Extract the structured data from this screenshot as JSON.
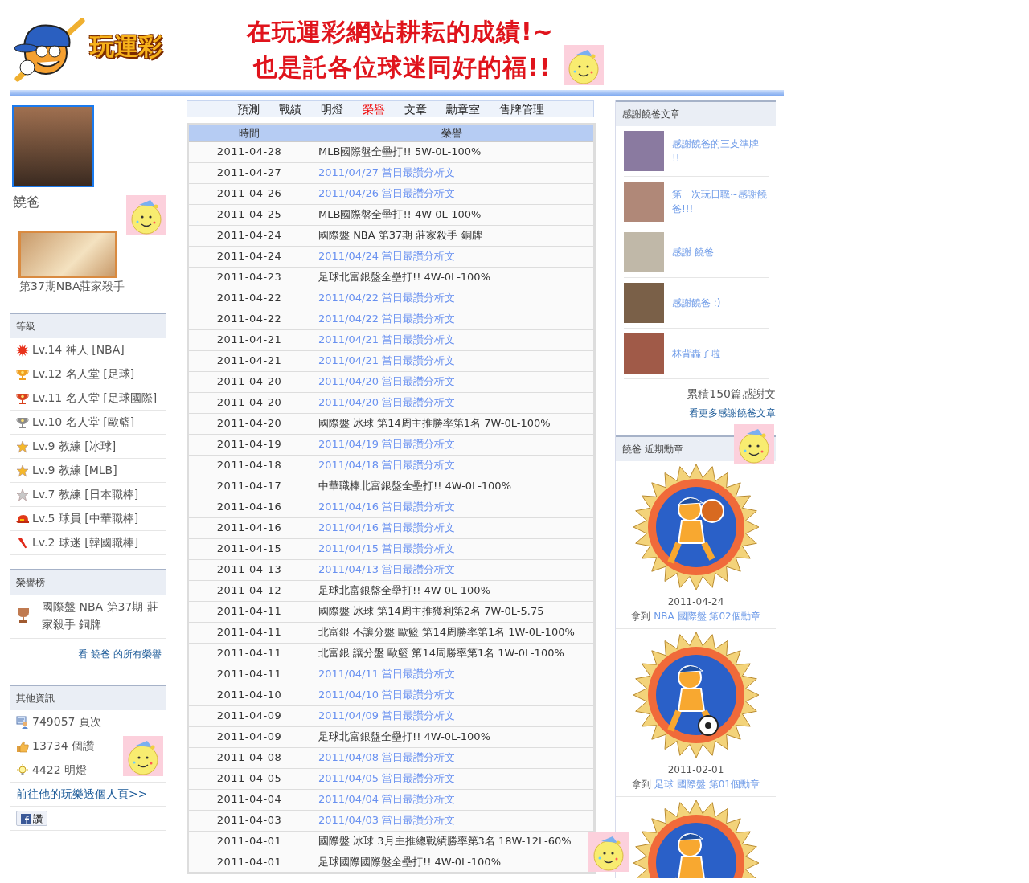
{
  "header": {
    "logo_text": "玩運彩",
    "slogan_lines": [
      "在玩運彩網站耕耘的成績!~",
      "也是託各位球迷同好的福!!"
    ]
  },
  "profile": {
    "name": "饒爸",
    "award_caption": "第37期NBA莊家殺手"
  },
  "levels": {
    "title": "等級",
    "items": [
      {
        "text": "Lv.14 神人 [NBA]",
        "kind": "burst",
        "color": "#e8321c"
      },
      {
        "text": "Lv.12 名人堂 [足球]",
        "kind": "trophy",
        "color": "#f0a020"
      },
      {
        "text": "Lv.11 名人堂 [足球國際]",
        "kind": "trophy",
        "color": "#d8401c"
      },
      {
        "text": "Lv.10 名人堂 [歐籃]",
        "kind": "trophy",
        "color": "#8a8a8a"
      },
      {
        "text": "Lv.9 教練 [冰球]",
        "kind": "star",
        "color": "#f5b82a"
      },
      {
        "text": "Lv.9 教練 [MLB]",
        "kind": "star",
        "color": "#f5b82a"
      },
      {
        "text": "Lv.7 教練 [日本職棒]",
        "kind": "star",
        "color": "#c8c8c8"
      },
      {
        "text": "Lv.5 球員 [中華職棒]",
        "kind": "cap",
        "color": "#e03a1a"
      },
      {
        "text": "Lv.2 球迷 [韓國職棒]",
        "kind": "horn",
        "color": "#e02a1a"
      }
    ]
  },
  "honors": {
    "title": "榮譽榜",
    "items": [
      {
        "text": "國際盤 NBA 第37期 莊家殺手 銅牌"
      }
    ],
    "more_link": "看 饒爸 的所有榮譽"
  },
  "other_info": {
    "title": "其他資訊",
    "items": [
      {
        "text": "749057 頁次",
        "kind": "views"
      },
      {
        "text": "13734 個讚",
        "kind": "like"
      },
      {
        "text": "4422 明燈",
        "kind": "bulb"
      }
    ],
    "page_link": "前往他的玩樂透個人頁>>",
    "like_button": "讚"
  },
  "tabs": [
    {
      "label": "預測",
      "selected": false
    },
    {
      "label": "戰績",
      "selected": false
    },
    {
      "label": "明燈",
      "selected": false
    },
    {
      "label": "榮譽",
      "selected": true
    },
    {
      "label": "文章",
      "selected": false
    },
    {
      "label": "勳章室",
      "selected": false
    },
    {
      "label": "售牌管理",
      "selected": false
    }
  ],
  "table": {
    "columns": [
      "時間",
      "榮譽"
    ],
    "rows": [
      {
        "date": "2011-04-28",
        "honor": "MLB國際盤全壘打!! 5W-0L-100%",
        "kind": "text"
      },
      {
        "date": "2011-04-27",
        "honor": "2011/04/27 當日最讚分析文",
        "kind": "link"
      },
      {
        "date": "2011-04-26",
        "honor": "2011/04/26 當日最讚分析文",
        "kind": "link"
      },
      {
        "date": "2011-04-25",
        "honor": "MLB國際盤全壘打!! 4W-0L-100%",
        "kind": "text"
      },
      {
        "date": "2011-04-24",
        "honor": "國際盤 NBA 第37期 莊家殺手 銅牌",
        "kind": "text"
      },
      {
        "date": "2011-04-24",
        "honor": "2011/04/24 當日最讚分析文",
        "kind": "link"
      },
      {
        "date": "2011-04-23",
        "honor": "足球北富銀盤全壘打!! 4W-0L-100%",
        "kind": "text"
      },
      {
        "date": "2011-04-22",
        "honor": "2011/04/22 當日最讚分析文",
        "kind": "link"
      },
      {
        "date": "2011-04-22",
        "honor": "2011/04/22 當日最讚分析文",
        "kind": "link"
      },
      {
        "date": "2011-04-21",
        "honor": "2011/04/21 當日最讚分析文",
        "kind": "link"
      },
      {
        "date": "2011-04-21",
        "honor": "2011/04/21 當日最讚分析文",
        "kind": "link"
      },
      {
        "date": "2011-04-20",
        "honor": "2011/04/20 當日最讚分析文",
        "kind": "link"
      },
      {
        "date": "2011-04-20",
        "honor": "2011/04/20 當日最讚分析文",
        "kind": "link"
      },
      {
        "date": "2011-04-20",
        "honor": "國際盤 冰球 第14周主推勝率第1名 7W-0L-100%",
        "kind": "text"
      },
      {
        "date": "2011-04-19",
        "honor": "2011/04/19 當日最讚分析文",
        "kind": "link"
      },
      {
        "date": "2011-04-18",
        "honor": "2011/04/18 當日最讚分析文",
        "kind": "link"
      },
      {
        "date": "2011-04-17",
        "honor": "中華職棒北富銀盤全壘打!! 4W-0L-100%",
        "kind": "text"
      },
      {
        "date": "2011-04-16",
        "honor": "2011/04/16 當日最讚分析文",
        "kind": "link"
      },
      {
        "date": "2011-04-16",
        "honor": "2011/04/16 當日最讚分析文",
        "kind": "link"
      },
      {
        "date": "2011-04-15",
        "honor": "2011/04/15 當日最讚分析文",
        "kind": "link"
      },
      {
        "date": "2011-04-13",
        "honor": "2011/04/13 當日最讚分析文",
        "kind": "link"
      },
      {
        "date": "2011-04-12",
        "honor": "足球北富銀盤全壘打!! 4W-0L-100%",
        "kind": "text"
      },
      {
        "date": "2011-04-11",
        "honor": "國際盤 冰球 第14周主推獲利第2名 7W-0L-5.75",
        "kind": "text"
      },
      {
        "date": "2011-04-11",
        "honor": "北富銀 不讓分盤 歐籃 第14周勝率第1名 1W-0L-100%",
        "kind": "text"
      },
      {
        "date": "2011-04-11",
        "honor": "北富銀 讓分盤 歐籃 第14周勝率第1名 1W-0L-100%",
        "kind": "text"
      },
      {
        "date": "2011-04-11",
        "honor": "2011/04/11 當日最讚分析文",
        "kind": "link"
      },
      {
        "date": "2011-04-10",
        "honor": "2011/04/10 當日最讚分析文",
        "kind": "link"
      },
      {
        "date": "2011-04-09",
        "honor": "2011/04/09 當日最讚分析文",
        "kind": "link"
      },
      {
        "date": "2011-04-09",
        "honor": "足球北富銀盤全壘打!! 4W-0L-100%",
        "kind": "text"
      },
      {
        "date": "2011-04-08",
        "honor": "2011/04/08 當日最讚分析文",
        "kind": "link"
      },
      {
        "date": "2011-04-05",
        "honor": "2011/04/05 當日最讚分析文",
        "kind": "link"
      },
      {
        "date": "2011-04-04",
        "honor": "2011/04/04 當日最讚分析文",
        "kind": "link"
      },
      {
        "date": "2011-04-03",
        "honor": "2011/04/03 當日最讚分析文",
        "kind": "link"
      },
      {
        "date": "2011-04-01",
        "honor": "國際盤 冰球 3月主推總戰績勝率第3名 18W-12L-60%",
        "kind": "text"
      },
      {
        "date": "2011-04-01",
        "honor": "足球國際國際盤全壘打!! 4W-0L-100%",
        "kind": "text"
      }
    ]
  },
  "thanks": {
    "title": "感謝饒爸文章",
    "articles": [
      {
        "title": "感謝饒爸的三支準牌 !!"
      },
      {
        "title": "第一次玩日職~感謝饒爸!!!"
      },
      {
        "title": "感謝 饒爸"
      },
      {
        "title": "感謝饒爸 :)"
      },
      {
        "title": "林背轟了啦"
      }
    ],
    "total": "累積150篇感謝文",
    "more_link": "看更多感謝饒爸文章"
  },
  "medals": {
    "title": "饒爸 近期勳章",
    "items": [
      {
        "date": "2011-04-24",
        "prefix": "拿到",
        "link": "NBA 國際盤 第02個勳章",
        "kind": "basketball"
      },
      {
        "date": "2011-02-01",
        "prefix": "拿到",
        "link": "足球 國際盤 第01個勳章",
        "kind": "soccer"
      },
      {
        "kind": "runner"
      }
    ]
  }
}
